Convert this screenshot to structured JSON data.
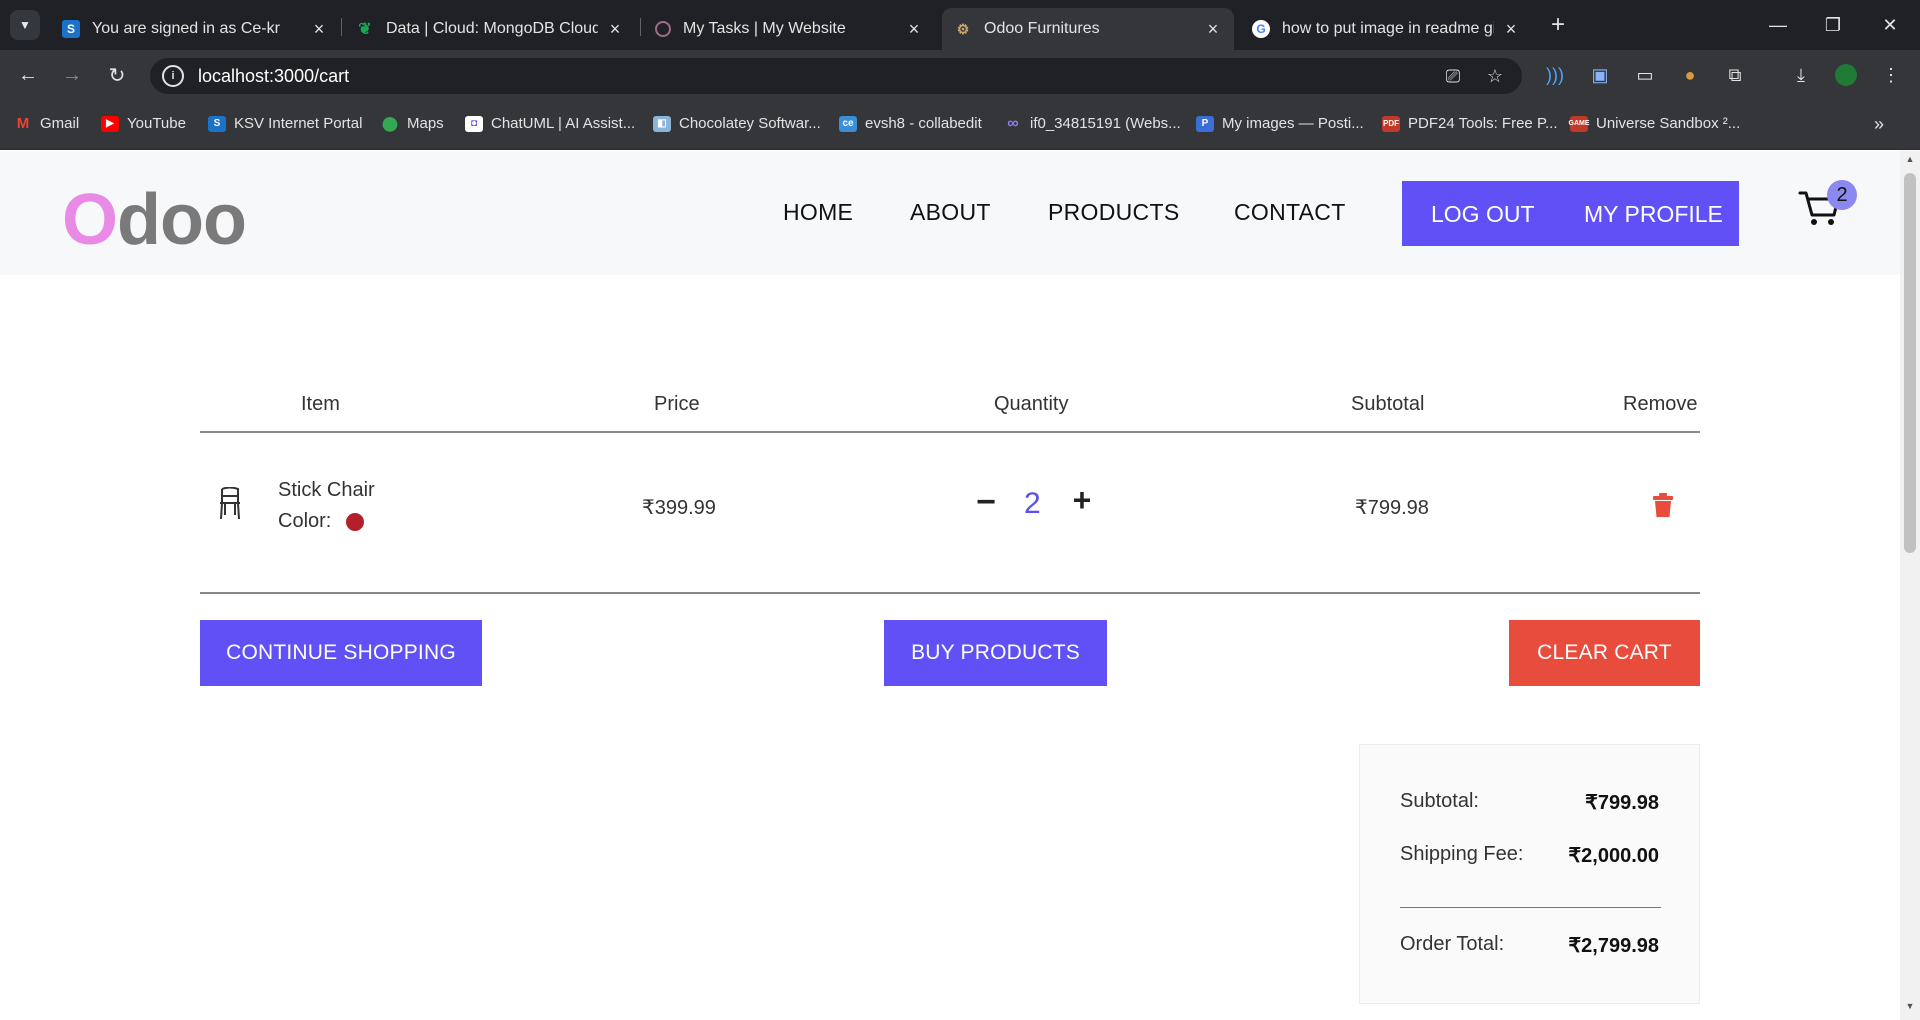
{
  "browser": {
    "tabs": [
      {
        "title": "You are signed in as Ce-kr",
        "icon": "s-icon",
        "active": false
      },
      {
        "title": "Data | Cloud: MongoDB Cloud",
        "icon": "mongodb-leaf-icon",
        "active": false
      },
      {
        "title": "My Tasks | My Website",
        "icon": "circle-icon",
        "active": false
      },
      {
        "title": "Odoo Furnitures",
        "icon": "odoo-icon",
        "active": true
      },
      {
        "title": "how to put image in readme gi",
        "icon": "google-icon",
        "active": false
      }
    ],
    "url": "localhost:3000/cart",
    "bookmarks": [
      {
        "label": "Gmail",
        "icon": "gmail-icon"
      },
      {
        "label": "YouTube",
        "icon": "youtube-icon"
      },
      {
        "label": "KSV Internet Portal",
        "icon": "s-icon"
      },
      {
        "label": "Maps",
        "icon": "maps-pin-icon"
      },
      {
        "label": "ChatUML | AI Assist...",
        "icon": "chatuml-icon"
      },
      {
        "label": "Chocolatey Softwar...",
        "icon": "chocolatey-icon"
      },
      {
        "label": "evsh8 - collabedit",
        "icon": "ce-icon"
      },
      {
        "label": "if0_34815191 (Webs...",
        "icon": "infinity-icon"
      },
      {
        "label": "My images — Posti...",
        "icon": "postimages-icon"
      },
      {
        "label": "PDF24 Tools: Free P...",
        "icon": "pdf24-icon"
      },
      {
        "label": "Universe Sandbox ²...",
        "icon": "game-icon"
      }
    ]
  },
  "site": {
    "logo_first": "O",
    "logo_rest": "doo",
    "nav": {
      "home": "HOME",
      "about": "ABOUT",
      "products": "PRODUCTS",
      "contact": "CONTACT"
    },
    "logout": "LOG OUT",
    "profile": "MY PROFILE",
    "cart_count": "2"
  },
  "cart": {
    "headers": {
      "item": "Item",
      "price": "Price",
      "quantity": "Quantity",
      "subtotal": "Subtotal",
      "remove": "Remove"
    },
    "items": [
      {
        "name": "Stick Chair",
        "color_label": "Color:",
        "color": "#b3202c",
        "price": "₹399.99",
        "quantity": "2",
        "subtotal": "₹799.98"
      }
    ],
    "buttons": {
      "continue": "CONTINUE SHOPPING",
      "buy": "BUY PRODUCTS",
      "clear": "CLEAR CART"
    },
    "summary": {
      "subtotal_label": "Subtotal:",
      "subtotal_value": "₹799.98",
      "shipping_label": "Shipping Fee:",
      "shipping_value": "₹2,000.00",
      "total_label": "Order Total:",
      "total_value": "₹2,799.98"
    }
  },
  "colors": {
    "primary": "#6050f5",
    "danger": "#e84c3d",
    "logo_accent": "#e88ae6"
  }
}
